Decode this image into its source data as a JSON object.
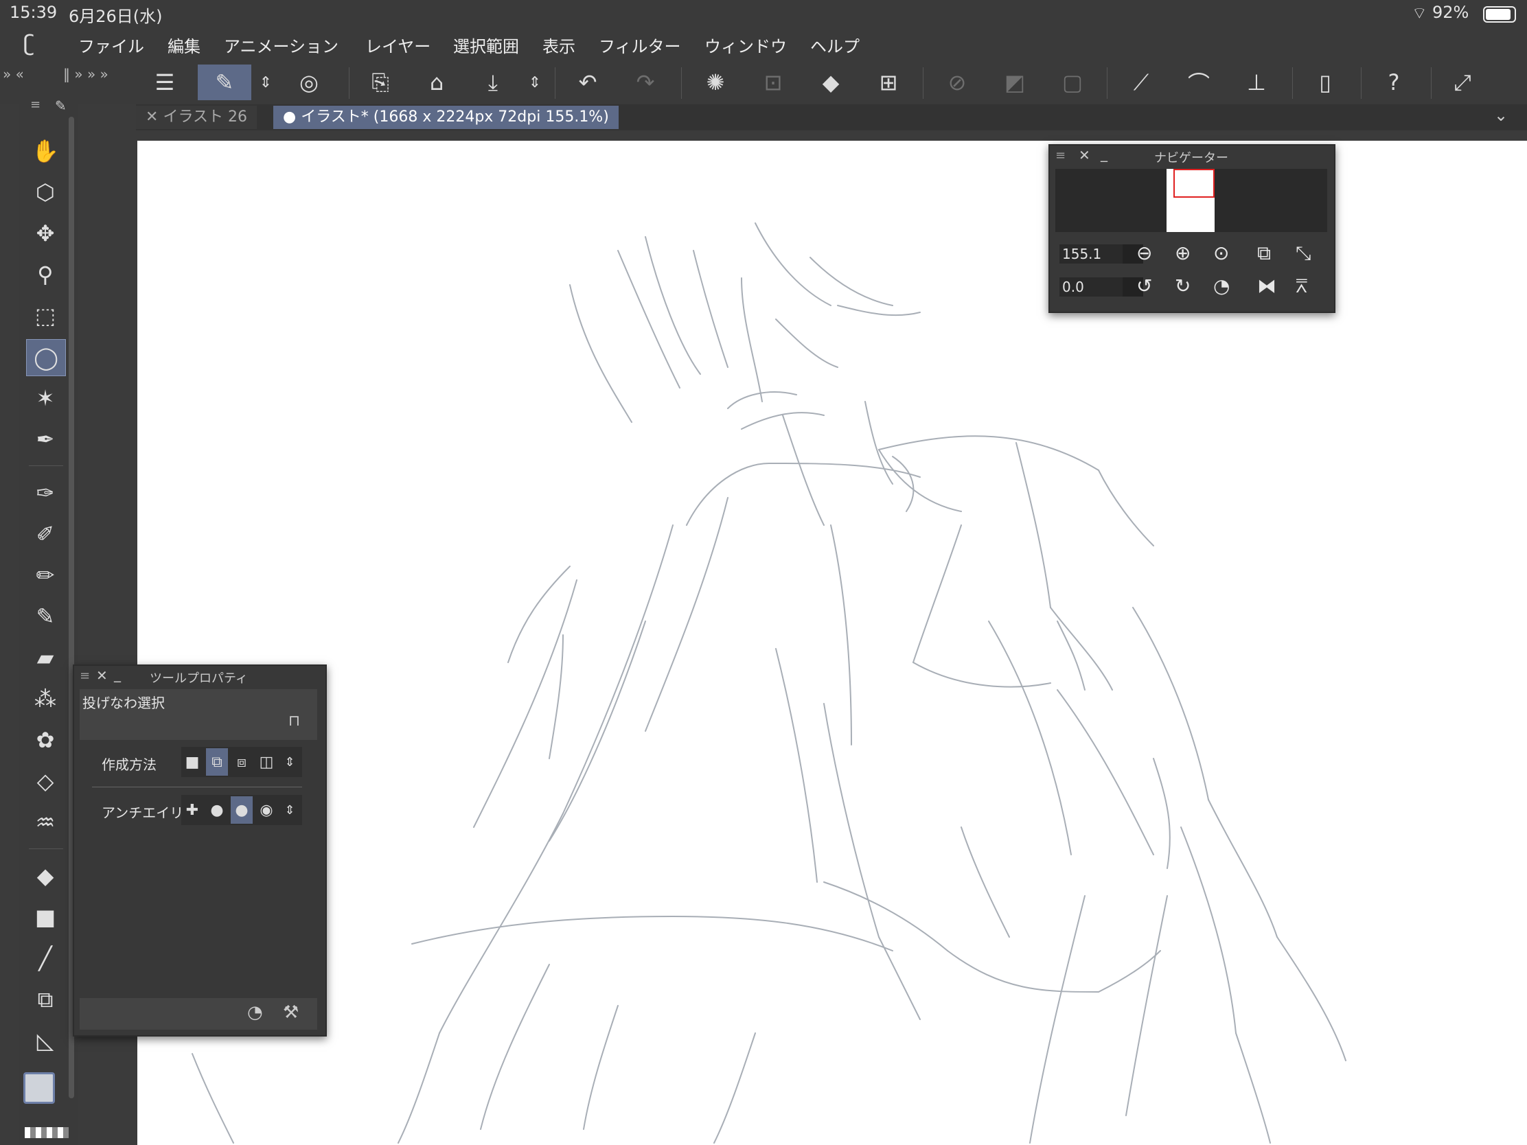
{
  "status": {
    "time": "15:39",
    "date": "6月26日(水)",
    "battery": "92%"
  },
  "menu": {
    "items": [
      "ファイル",
      "編集",
      "アニメーション",
      "レイヤー",
      "選択範囲",
      "表示",
      "フィルター",
      "ウィンドウ",
      "ヘルプ"
    ]
  },
  "tabs": [
    {
      "label": "イラスト 26",
      "prefix": "✕"
    },
    {
      "label": "イラスト* (1668 x 2224px 72dpi 155.1%)",
      "prefix": "●"
    }
  ],
  "navigator": {
    "title": "ナビゲーター",
    "zoom": "155.1",
    "rotation": "0.0"
  },
  "tool_property": {
    "title": "ツールプロパティ",
    "tool_name": "投げなわ選択",
    "row1_label": "作成方法",
    "row2_label": "アンチエイリア"
  },
  "colors": {
    "accent": "#5d6a88",
    "panel": "#383838",
    "canvas": "#ffffff",
    "sketch": "#a8aeb6"
  }
}
